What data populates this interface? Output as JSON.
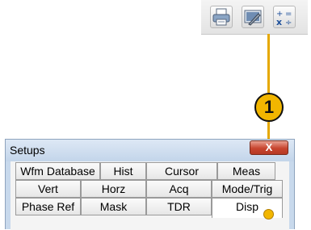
{
  "toolbar": {
    "icons": [
      "printer-icon",
      "setup-wrench-icon",
      "calculator-icon"
    ]
  },
  "callout": {
    "number": "1"
  },
  "dialog": {
    "title": "Setups",
    "close_label": "X",
    "tab_rows": [
      [
        "Wfm Database",
        "Hist",
        "Cursor",
        "Meas"
      ],
      [
        "Vert",
        "Horz",
        "Acq",
        "Mode/Trig"
      ],
      [
        "Phase Ref",
        "Mask",
        "TDR",
        "Disp"
      ]
    ],
    "active_tab": "Disp"
  },
  "colors": {
    "callout_fill": "#f2b600",
    "callout_line": "#e6a800",
    "dialog_frame": "#c8d9ec",
    "close_button": "#c7452f"
  }
}
